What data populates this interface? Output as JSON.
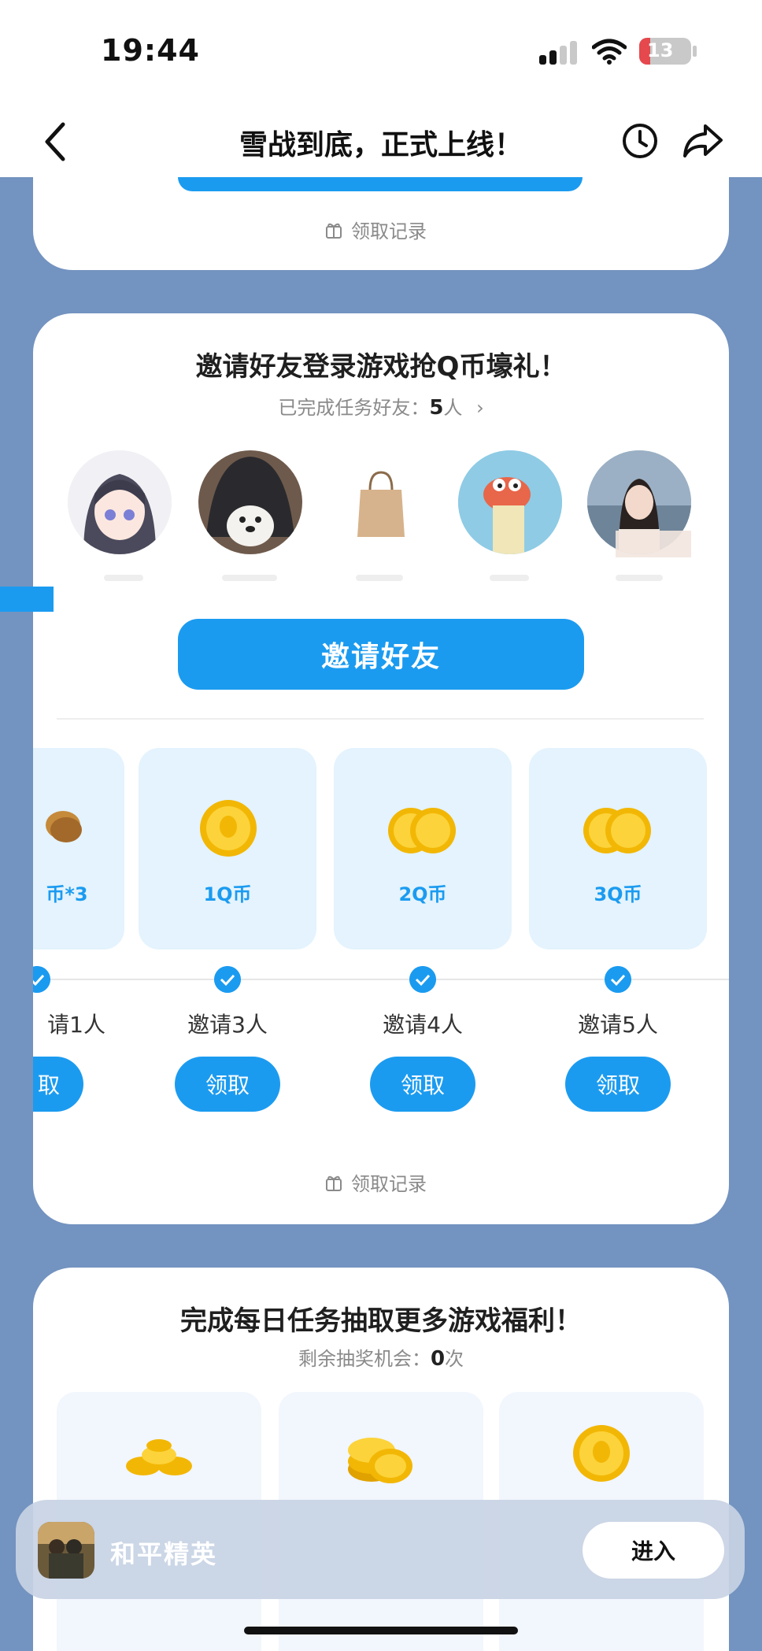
{
  "status_bar": {
    "time": "19:44",
    "battery": "13"
  },
  "nav": {
    "title": "雪战到底，正式上线！"
  },
  "card1": {
    "record_link": "领取记录"
  },
  "invite_card": {
    "title": "邀请好友登录游戏抢Q币壕礼！",
    "subtitle_prefix": "已完成任务好友：",
    "subtitle_count": "5",
    "subtitle_suffix": "人",
    "invite_button": "邀请好友",
    "rewards": [
      {
        "label": "币*3"
      },
      {
        "label": "1Q币"
      },
      {
        "label": "2Q币"
      },
      {
        "label": "3Q币"
      }
    ],
    "steps": [
      {
        "label": "请1人",
        "button": "取"
      },
      {
        "label": "邀请3人",
        "button": "领取"
      },
      {
        "label": "邀请4人",
        "button": "领取"
      },
      {
        "label": "邀请5人",
        "button": "领取"
      }
    ],
    "record_link": "领取记录"
  },
  "daily_card": {
    "title": "完成每日任务抽取更多游戏福利！",
    "subtitle_prefix": "剩余抽奖机会：",
    "subtitle_count": "0",
    "subtitle_suffix": "次"
  },
  "app_bar": {
    "app_name": "和平精英",
    "enter_button": "进入"
  },
  "colors": {
    "accent": "#1b9bf0",
    "background": "#7393c0",
    "reward_bg": "#e4f3fd"
  }
}
